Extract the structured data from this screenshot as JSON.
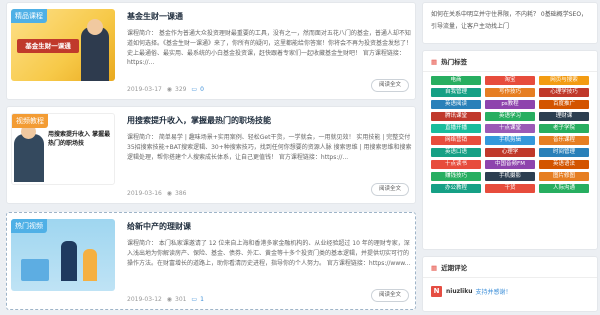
{
  "posts": [
    {
      "tag": "精品课程",
      "tag_color": "#4fb0e6",
      "title": "基金生财一课通",
      "excerpt": "课程简介： 基金作为普通大众投资理财最重要的工具，没有之一，然而面对五花八门的基金，普通人却不知道如何选择。《基金生财一课通》来了，你所有的疑问，这里都能给你答案！你将会不再为投资基金发愁了！史上最通俗、最实用、最系统的小白基金投资课，赶快跟着专家们一起收藏基金生财吧！ 官方课程链接：https://...",
      "thumb_caption": "基金生财一课通",
      "date": "2019-03-17",
      "views": "329",
      "comments": "0",
      "read_label": "阅读全文"
    },
    {
      "tag": "视频教程",
      "tag_color": "#f39c34",
      "title": "用搜索提升收入，掌握最热门的职场技能",
      "excerpt": "课程简介： 简单易学 | 趣味场景+实用案例、轻松Get干货，一学就会，一用就见效！ 实用技能 | 完整交付35招搜索技能+BAT搜索逻辑、30+种搜索技巧，找到任何你想要的资源人脉 搜索思维 | 用搜索思维和搜索逻辑处理，帮你搭建个人搜索成长体系，让自己更值钱！ 官方课程链接：https://...",
      "thumb_caption": "用搜索提升收入 掌握最热门的职场技",
      "date": "2019-03-16",
      "views": "386",
      "comments": "",
      "read_label": "阅读全文"
    },
    {
      "tag": "热门视频",
      "tag_color": "#4fb0e6",
      "title": "给新中产的理财课",
      "excerpt": "课程简介： 本门私家课邀请了 12 位来自上海和香港多家金融机构的、从业经验超过 10 年的理财专家，深入浅出地为你解读房产、保险、基金、债券、外汇、黄金等十多个投资门类的基本逻辑，并提供切实可行的操作方法。在财富增长的道路上，助你看清历史进程，指导你的个人努力。 官方课程链接：https://www...",
      "thumb_caption": "",
      "date": "2019-03-12",
      "views": "301",
      "comments": "1",
      "read_label": "阅读全文"
    }
  ],
  "sidebar": {
    "search_text": "如何在关系中明立并守住界限，不内耗？ 0基础概学SEO，引导流量，让客户主动找上门",
    "tags_title": "热门标签",
    "tags": [
      {
        "label": "电商",
        "color": "#27ae60"
      },
      {
        "label": "淘宝",
        "color": "#e74c3c"
      },
      {
        "label": "网页与搜索",
        "color": "#f39c12"
      },
      {
        "label": "自我管理",
        "color": "#16a085"
      },
      {
        "label": "写作技巧",
        "color": "#e67e22"
      },
      {
        "label": "心理学技巧",
        "color": "#c0392b"
      },
      {
        "label": "英语阅读",
        "color": "#2980b9"
      },
      {
        "label": "ps教程",
        "color": "#8e44ad"
      },
      {
        "label": "百度推广",
        "color": "#d35400"
      },
      {
        "label": "腾讯课堂",
        "color": "#c0392b"
      },
      {
        "label": "英语学习",
        "color": "#27ae60"
      },
      {
        "label": "理财课",
        "color": "#2c3e50"
      },
      {
        "label": "直播开播",
        "color": "#1abc9c"
      },
      {
        "label": "十点课堂",
        "color": "#9b59b6"
      },
      {
        "label": "老子学院",
        "color": "#27ae60"
      },
      {
        "label": "网络营销",
        "color": "#e74c3c"
      },
      {
        "label": "手机剪辑",
        "color": "#3498db"
      },
      {
        "label": "音乐课程",
        "color": "#e67e22"
      },
      {
        "label": "英语口语",
        "color": "#16a085"
      },
      {
        "label": "心理学",
        "color": "#c0392b"
      },
      {
        "label": "时间管理",
        "color": "#2980b9"
      },
      {
        "label": "十点读书",
        "color": "#e74c3c"
      },
      {
        "label": "中国音频FM",
        "color": "#8e44ad"
      },
      {
        "label": "英语语法",
        "color": "#d35400"
      },
      {
        "label": "赚钱技巧",
        "color": "#27ae60"
      },
      {
        "label": "手机摄影",
        "color": "#2c3e50"
      },
      {
        "label": "图片修图",
        "color": "#e67e22"
      },
      {
        "label": "办公教程",
        "color": "#16a085"
      },
      {
        "label": "干货",
        "color": "#e74c3c"
      },
      {
        "label": "人际沟通",
        "color": "#27ae60"
      }
    ],
    "comments_title": "近期评论",
    "comment": {
      "avatar": "N",
      "name": "niuzliku",
      "text": "支持并感谢！"
    }
  }
}
